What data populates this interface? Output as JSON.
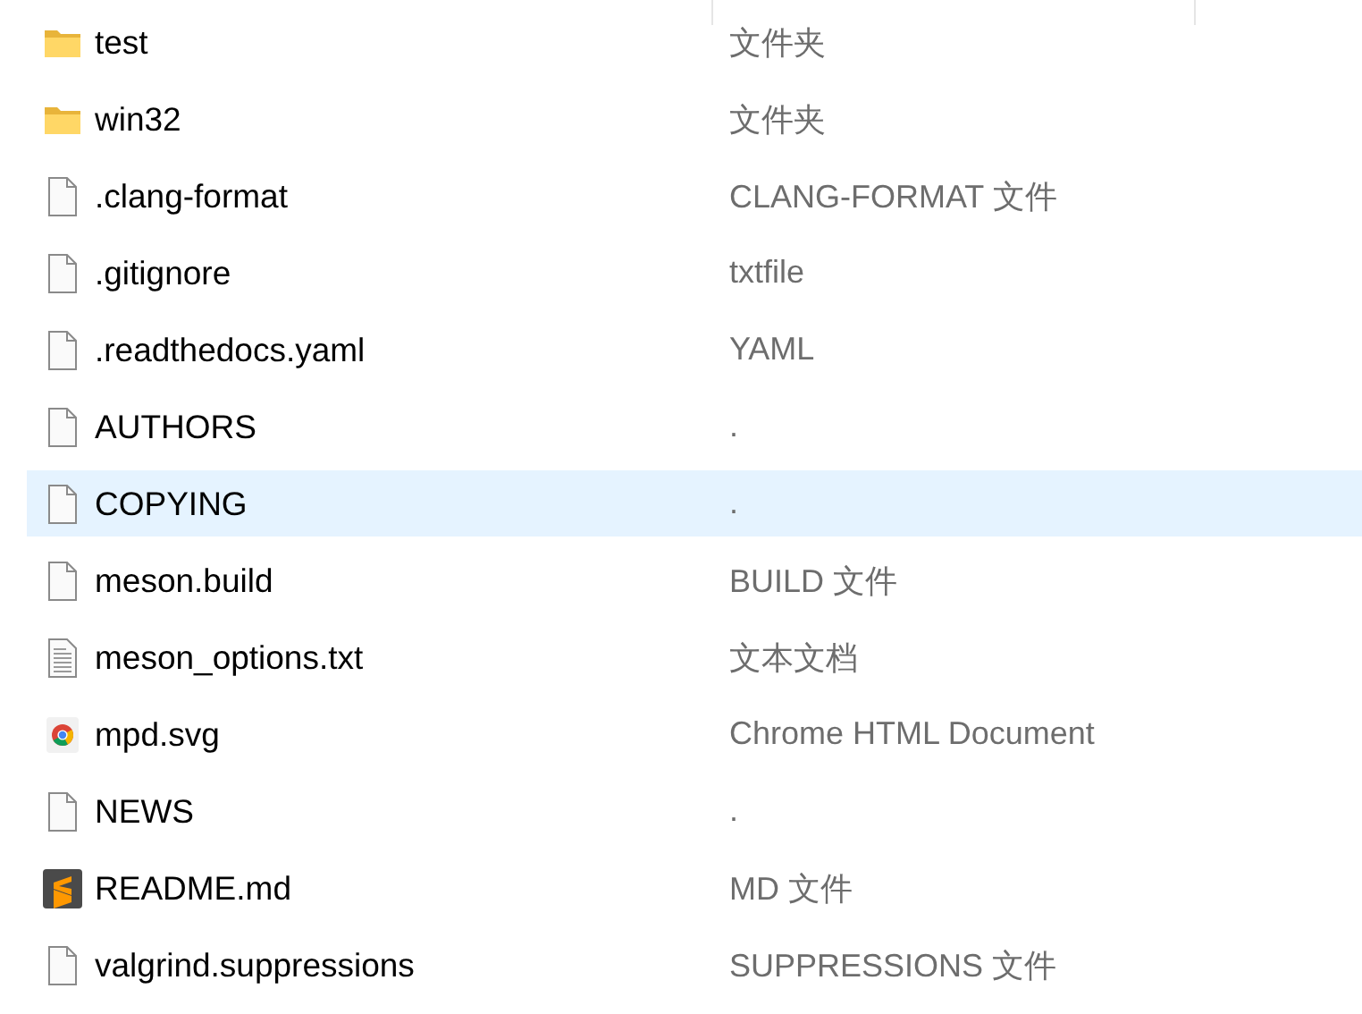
{
  "files": [
    {
      "name": "test",
      "type": "文件夹",
      "kind": "folder",
      "selected": false
    },
    {
      "name": "win32",
      "type": "文件夹",
      "kind": "folder",
      "selected": false
    },
    {
      "name": ".clang-format",
      "type": "CLANG-FORMAT 文件",
      "kind": "file",
      "selected": false
    },
    {
      "name": ".gitignore",
      "type": "txtfile",
      "kind": "file",
      "selected": false
    },
    {
      "name": ".readthedocs.yaml",
      "type": "YAML",
      "kind": "file",
      "selected": false
    },
    {
      "name": "AUTHORS",
      "type": ".",
      "kind": "file",
      "selected": false
    },
    {
      "name": "COPYING",
      "type": ".",
      "kind": "file",
      "selected": true
    },
    {
      "name": "meson.build",
      "type": "BUILD 文件",
      "kind": "file",
      "selected": false
    },
    {
      "name": "meson_options.txt",
      "type": "文本文档",
      "kind": "text",
      "selected": false
    },
    {
      "name": "mpd.svg",
      "type": "Chrome HTML Document",
      "kind": "chrome",
      "selected": false
    },
    {
      "name": "NEWS",
      "type": ".",
      "kind": "file",
      "selected": false
    },
    {
      "name": "README.md",
      "type": "MD 文件",
      "kind": "sublime",
      "selected": false
    },
    {
      "name": "valgrind.suppressions",
      "type": "SUPPRESSIONS 文件",
      "kind": "file",
      "selected": false
    }
  ]
}
